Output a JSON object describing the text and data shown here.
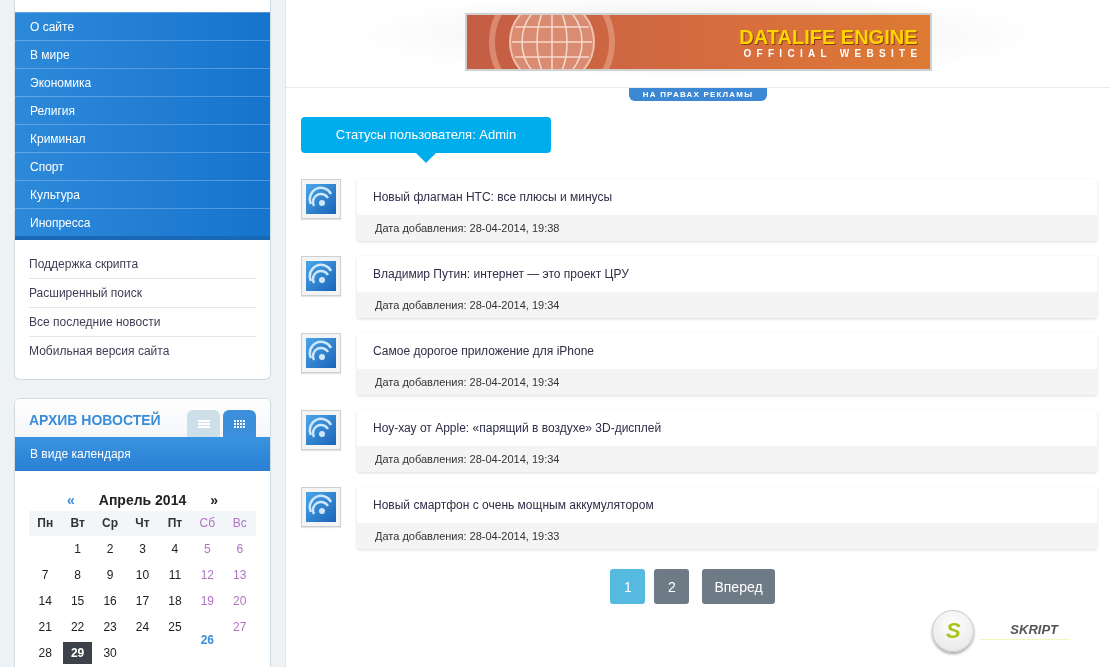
{
  "menu": {
    "items": [
      "О сайте",
      "В мире",
      "Экономика",
      "Религия",
      "Криминал",
      "Спорт",
      "Культура",
      "Инопресса"
    ]
  },
  "links": [
    "Поддержка скрипта",
    "Расширенный поиск",
    "Все последние новости",
    "Мобильная версия сайта"
  ],
  "archive": {
    "title": "АРХИВ НОВОСТЕЙ",
    "tabs": [
      {
        "kind": "list",
        "selected": false
      },
      {
        "kind": "grid",
        "selected": true
      }
    ],
    "mode_label": "В виде календаря",
    "calendar": {
      "prev": "«",
      "month": "Апрель 2014",
      "next": "»",
      "weekdays": [
        {
          "label": "Пн",
          "weekend": false
        },
        {
          "label": "Вт",
          "weekend": false
        },
        {
          "label": "Ср",
          "weekend": false
        },
        {
          "label": "Чт",
          "weekend": false
        },
        {
          "label": "Пт",
          "weekend": false
        },
        {
          "label": "Сб",
          "weekend": true
        },
        {
          "label": "Вс",
          "weekend": true
        }
      ],
      "weeks": [
        [
          {
            "day": "1",
            "weekend": false,
            "has_news": false,
            "selected": false
          },
          {
            "day": "2",
            "weekend": false,
            "has_news": false,
            "selected": false
          },
          {
            "day": "3",
            "weekend": false,
            "has_news": false,
            "selected": false
          },
          {
            "day": "4",
            "weekend": false,
            "has_news": false,
            "selected": false
          },
          {
            "day": "5",
            "weekend": true,
            "has_news": false,
            "selected": false
          },
          {
            "day": "6",
            "weekend": true,
            "has_news": false,
            "selected": false
          }
        ],
        [
          {
            "day": "7",
            "weekend": false,
            "has_news": false,
            "selected": false
          },
          {
            "day": "8",
            "weekend": false,
            "has_news": false,
            "selected": false
          },
          {
            "day": "9",
            "weekend": false,
            "has_news": false,
            "selected": false
          },
          {
            "day": "10",
            "weekend": false,
            "has_news": false,
            "selected": false
          },
          {
            "day": "11",
            "weekend": false,
            "has_news": false,
            "selected": false
          },
          {
            "day": "12",
            "weekend": true,
            "has_news": false,
            "selected": false
          },
          {
            "day": "13",
            "weekend": true,
            "has_news": false,
            "selected": false
          }
        ],
        [
          {
            "day": "14",
            "weekend": false,
            "has_news": false,
            "selected": false
          },
          {
            "day": "15",
            "weekend": false,
            "has_news": false,
            "selected": false
          },
          {
            "day": "16",
            "weekend": false,
            "has_news": false,
            "selected": false
          },
          {
            "day": "17",
            "weekend": false,
            "has_news": false,
            "selected": false
          },
          {
            "day": "18",
            "weekend": false,
            "has_news": false,
            "selected": false
          },
          {
            "day": "19",
            "weekend": true,
            "has_news": false,
            "selected": false
          },
          {
            "day": "20",
            "weekend": true,
            "has_news": false,
            "selected": false
          }
        ],
        [
          {
            "day": "21",
            "weekend": false,
            "has_news": false,
            "selected": false
          },
          {
            "day": "22",
            "weekend": false,
            "has_news": false,
            "selected": false
          },
          {
            "day": "23",
            "weekend": false,
            "has_news": false,
            "selected": false
          },
          {
            "day": "24",
            "weekend": false,
            "has_news": false,
            "selected": false
          },
          {
            "day": "25",
            "weekend": false,
            "has_news": false,
            "selected": false
          },
          {
            "day": "26",
            "weekend": true,
            "has_news": true,
            "selected": false
          },
          {
            "day": "27",
            "weekend": true,
            "has_news": false,
            "selected": false
          }
        ],
        [
          {
            "day": "28",
            "weekend": false,
            "has_news": false,
            "selected": false
          },
          {
            "day": "29",
            "weekend": false,
            "has_news": false,
            "selected": true
          },
          {
            "day": "30",
            "weekend": false,
            "has_news": false,
            "selected": false
          }
        ]
      ]
    }
  },
  "banner": {
    "title": "DATALIFE ENGINE",
    "subtitle": "OFFICIAL WEBSITE",
    "ad_label": "НА ПРАВАХ РЕКЛАМЫ"
  },
  "status_heading": "Статусы пользователя: Admin",
  "news": [
    {
      "title": "Новый флагман HTC: все плюсы и минусы",
      "date": "Дата добавления: 28-04-2014, 19:38"
    },
    {
      "title": "Владимир Путин: интернет — это проект ЦРУ",
      "date": "Дата добавления: 28-04-2014, 19:34"
    },
    {
      "title": "Самое дорогое приложение для iPhone",
      "date": "Дата добавления: 28-04-2014, 19:34"
    },
    {
      "title": "Ноу-хау от Apple: «парящий в воздухе» 3D-дисплей",
      "date": "Дата добавления: 28-04-2014, 19:34"
    },
    {
      "title": "Новый смартфон с очень мощным аккумулятором",
      "date": "Дата добавления: 28-04-2014, 19:33"
    }
  ],
  "pagination": {
    "pages": [
      {
        "label": "1",
        "selected": true
      },
      {
        "label": "2",
        "selected": false
      }
    ],
    "next": "Вперед"
  },
  "footer_logo": {
    "letter": "S",
    "name": "SKRIPT"
  }
}
